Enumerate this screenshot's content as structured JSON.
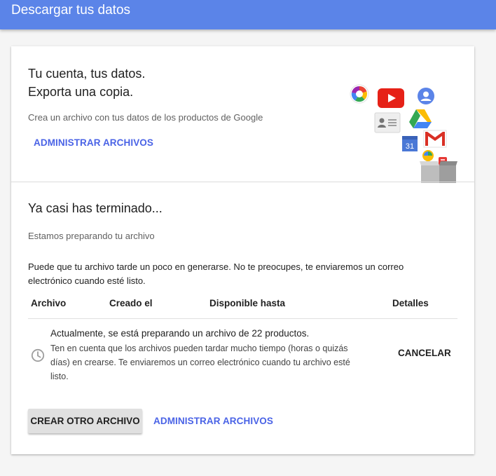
{
  "header": {
    "title": "Descargar tus datos"
  },
  "hero": {
    "title_line1": "Tu cuenta, tus datos.",
    "title_line2": "Exporta una copia.",
    "description": "Crea un archivo con tus datos de los productos de Google",
    "manage_link": "ADMINISTRAR ARCHIVOS",
    "product_icons": [
      "photos-icon",
      "youtube-icon",
      "profile-icon",
      "contacts-icon",
      "drive-icon",
      "calendar-icon",
      "gmail-icon",
      "hangouts-icon",
      "archive-box-icon"
    ],
    "calendar_day": "31"
  },
  "status": {
    "title": "Ya casi has terminado...",
    "preparing": "Estamos preparando tu archivo",
    "note": "Puede que tu archivo tarde un poco en generarse. No te preocupes, te enviaremos un correo electrónico cuando esté listo."
  },
  "table": {
    "headers": {
      "archivo": "Archivo",
      "creado": "Creado el",
      "disponible": "Disponible hasta",
      "detalles": "Detalles"
    },
    "row": {
      "main": "Actualmente, se está preparando un archivo de 22 productos.",
      "sub": "Ten en cuenta que los archivos pueden tardar mucho tiempo (horas o quizás días) en crearse. Te enviaremos un correo electrónico cuando tu archivo esté listo.",
      "status_icon": "clock-icon",
      "cancel": "CANCELAR"
    }
  },
  "actions": {
    "create_another": "CREAR OTRO ARCHIVO",
    "manage": "ADMINISTRAR ARCHIVOS"
  },
  "colors": {
    "header_bg": "#5b84e8",
    "link": "#4a63e6",
    "raised_button_bg": "#e0e0e0"
  }
}
